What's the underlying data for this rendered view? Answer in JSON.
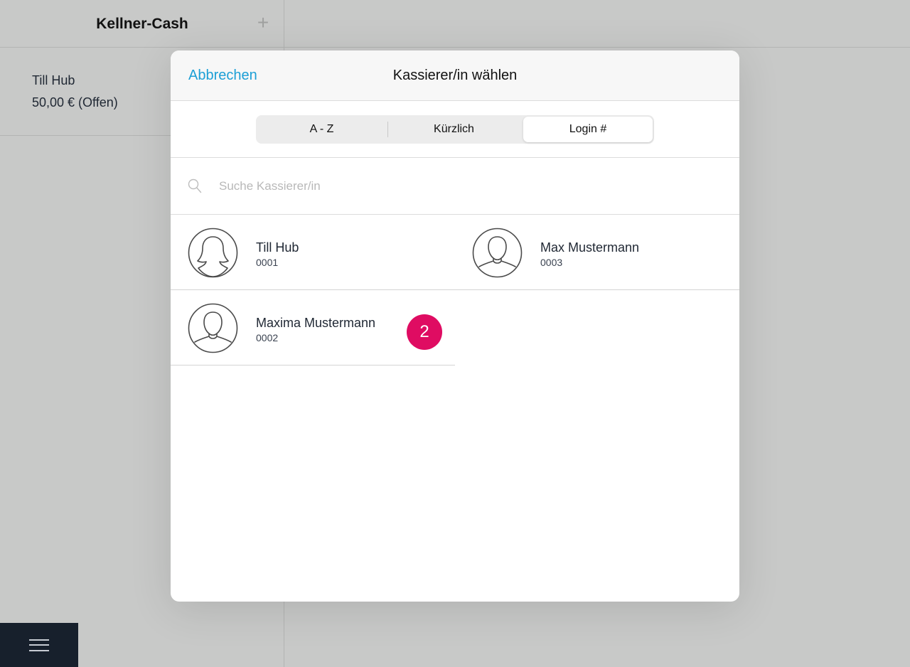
{
  "background": {
    "title": "Kellner-Cash",
    "plus_icon": "plus-icon",
    "order": {
      "name": "Till Hub",
      "amount": "50,00 € (Offen)"
    },
    "menu_icon": "hamburger-menu-icon"
  },
  "modal": {
    "cancel_label": "Abbrechen",
    "title": "Kassierer/in wählen",
    "segments": [
      {
        "label": "A - Z",
        "selected": false
      },
      {
        "label": "Kürzlich",
        "selected": false
      },
      {
        "label": "Login #",
        "selected": true
      }
    ],
    "search": {
      "placeholder": "Suche Kassierer/in",
      "value": "",
      "icon": "search-icon"
    },
    "cashiers": [
      {
        "name": "Till Hub",
        "number": "0001",
        "avatar": "female-avatar-icon",
        "badge": ""
      },
      {
        "name": "Max Mustermann",
        "number": "0003",
        "avatar": "male-avatar-icon",
        "badge": ""
      },
      {
        "name": "Maxima Mustermann",
        "number": "0002",
        "avatar": "male-avatar-icon",
        "badge": "2"
      }
    ]
  },
  "colors": {
    "accent": "#1c9fd6",
    "badge": "#df0c62",
    "menu_bar": "#17202c",
    "overlay": "#c8c9c8"
  }
}
